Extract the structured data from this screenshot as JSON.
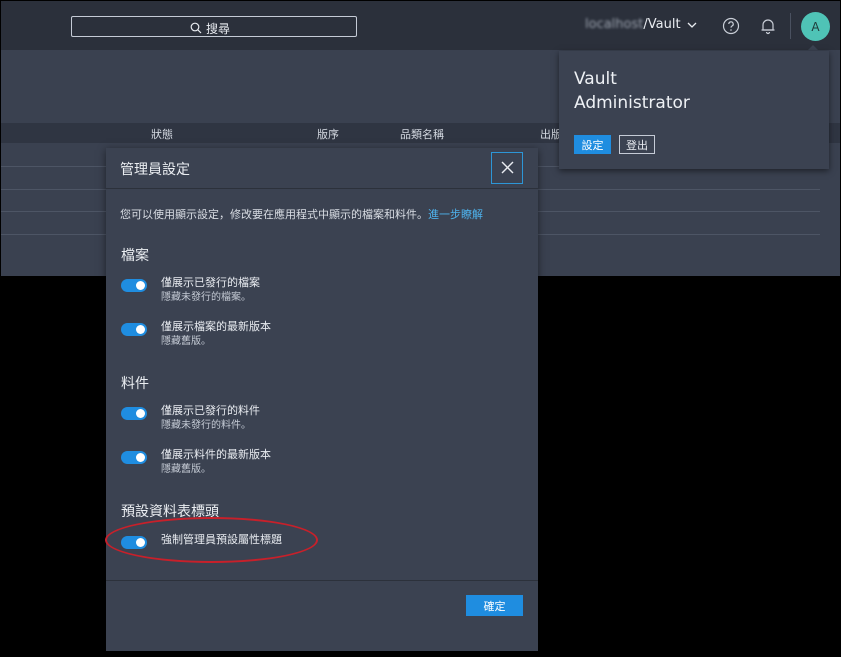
{
  "header": {
    "search_label": "搜尋",
    "vault_host_blurred": "localhost",
    "vault_path": "/Vault",
    "avatar_initial": "A"
  },
  "table": {
    "columns": [
      "狀態",
      "版序",
      "品類名稱",
      "出版"
    ]
  },
  "dialog": {
    "title": "管理員設定",
    "description": "您可以使用顯示設定，修改要在應用程式中顯示的檔案和料件。",
    "learn_more": "進一步瞭解",
    "sections": [
      {
        "title": "檔案",
        "options": [
          {
            "label": "僅展示已發行的檔案",
            "sub": "隱藏未發行的檔案。",
            "on": true
          },
          {
            "label": "僅展示檔案的最新版本",
            "sub": "隱藏舊版。",
            "on": true
          }
        ]
      },
      {
        "title": "料件",
        "options": [
          {
            "label": "僅展示已發行的料件",
            "sub": "隱藏未發行的料件。",
            "on": true
          },
          {
            "label": "僅展示料件的最新版本",
            "sub": "隱藏舊版。",
            "on": true
          }
        ]
      },
      {
        "title": "預設資料表標頭",
        "options": [
          {
            "label": "強制管理員預設屬性標題",
            "on": true
          }
        ]
      }
    ],
    "ok_label": "確定"
  },
  "user_popup": {
    "name_line1": "Vault",
    "name_line2": "Administrator",
    "settings_label": "設定",
    "logout_label": "登出"
  },
  "colors": {
    "accent": "#1f8de0",
    "link": "#4eb2ec",
    "annotation": "#c8202a",
    "avatar": "#4fc3b6"
  },
  "icons": [
    "search-icon",
    "chevron-down-icon",
    "help-icon",
    "bell-icon",
    "close-icon"
  ]
}
